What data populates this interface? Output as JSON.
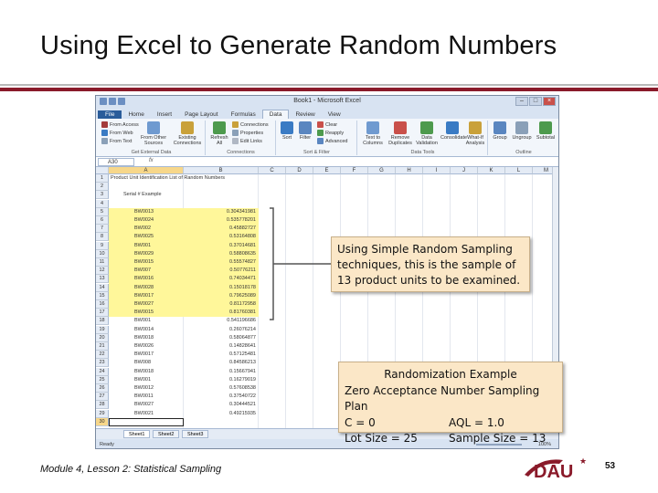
{
  "slide": {
    "title": "Using Excel to Generate Random Numbers",
    "footer": "Module 4, Lesson 2: Statistical Sampling",
    "page_number": "53",
    "logo_text": "DAU",
    "accent_color": "#8a1a2a"
  },
  "excel": {
    "window_title": "Book1 - Microsoft Excel",
    "tabs": [
      {
        "label": "File"
      },
      {
        "label": "Home"
      },
      {
        "label": "Insert"
      },
      {
        "label": "Page Layout"
      },
      {
        "label": "Formulas"
      },
      {
        "label": "Data"
      },
      {
        "label": "Review"
      },
      {
        "label": "View"
      }
    ],
    "ribbon": {
      "from_access": "From Access",
      "from_web": "From Web",
      "from_text": "From Text",
      "from_other_sources": "From Other Sources",
      "existing_connections": "Existing Connections",
      "refresh_all": "Refresh All",
      "connections": "Connections",
      "properties": "Properties",
      "edit_links": "Edit Links",
      "sort": "Sort",
      "filter": "Filter",
      "clear": "Clear",
      "reapply": "Reapply",
      "advanced": "Advanced",
      "text_to_columns": "Text to Columns",
      "remove_duplicates": "Remove Duplicates",
      "data_validation": "Data Validation",
      "consolidate": "Consolidate",
      "what_if": "What-If Analysis",
      "group": "Group",
      "ungroup": "Ungroup",
      "subtotal": "Subtotal",
      "group_get_external": "Get External Data",
      "group_connections": "Connections",
      "group_sort_filter": "Sort & Filter",
      "group_data_tools": "Data Tools",
      "group_outline": "Outline"
    },
    "name_box": "A30",
    "fx": "fx",
    "columns": [
      "A",
      "B",
      "C",
      "D",
      "E",
      "F",
      "G",
      "H",
      "I",
      "J",
      "K",
      "L",
      "M"
    ],
    "row_numbers": [
      "1",
      "2",
      "3",
      "4",
      "5",
      "6",
      "7",
      "8",
      "9",
      "10",
      "11",
      "12",
      "13",
      "14",
      "15",
      "16",
      "17",
      "18",
      "19",
      "20",
      "21",
      "22",
      "23",
      "24",
      "25",
      "26",
      "27",
      "28",
      "29",
      "30"
    ],
    "heading": "Product Unit Identification  List of Random Numbers",
    "subheading": "Serial # Example",
    "rows": [
      {
        "id": "BW0013",
        "num": "0.304341981"
      },
      {
        "id": "BW0024",
        "num": "0.535778201"
      },
      {
        "id": "BW002",
        "num": "0.45882727"
      },
      {
        "id": "BW0025",
        "num": "0.53164808"
      },
      {
        "id": "BW001",
        "num": "0.37014681"
      },
      {
        "id": "BW0029",
        "num": "0.58808635"
      },
      {
        "id": "BW0015",
        "num": "0.55574827"
      },
      {
        "id": "BW007",
        "num": "0.50776211"
      },
      {
        "id": "BW0016",
        "num": "0.74034471"
      },
      {
        "id": "BW0028",
        "num": "0.15018178"
      },
      {
        "id": "BW0017",
        "num": "0.79625089"
      },
      {
        "id": "BW0027",
        "num": "0.81172958"
      },
      {
        "id": "BW0015",
        "num": "0.81760381"
      },
      {
        "id": "BW001",
        "num": "0.541196686"
      },
      {
        "id": "BW0014",
        "num": "0.26076214"
      },
      {
        "id": "BW0018",
        "num": "0.58064877"
      },
      {
        "id": "BW0026",
        "num": "0.14828641"
      },
      {
        "id": "BW0017",
        "num": "0.57125481"
      },
      {
        "id": "BW008",
        "num": "0.84586213"
      },
      {
        "id": "BW0018",
        "num": "0.15667941"
      },
      {
        "id": "BW001",
        "num": "0.16279019"
      },
      {
        "id": "BW0012",
        "num": "0.57608538"
      },
      {
        "id": "BW0011",
        "num": "0.37540722"
      },
      {
        "id": "BW0027",
        "num": "0.30444521"
      },
      {
        "id": "BW0021",
        "num": "0.49215935"
      }
    ],
    "sheet_tabs": [
      "Sheet1",
      "Sheet2",
      "Sheet3"
    ],
    "status": "Ready",
    "zoom": "100%"
  },
  "callouts": {
    "srs_text": "Using Simple Random Sampling techniques, this is the sample of 13 product units to be examined.",
    "example_title": "Randomization Example",
    "plan": "Zero Acceptance Number Sampling Plan",
    "c_value": "C = 0",
    "aql": "AQL = 1.0",
    "lot_size": "Lot Size = 25",
    "sample_size": "Sample Size = 13"
  }
}
